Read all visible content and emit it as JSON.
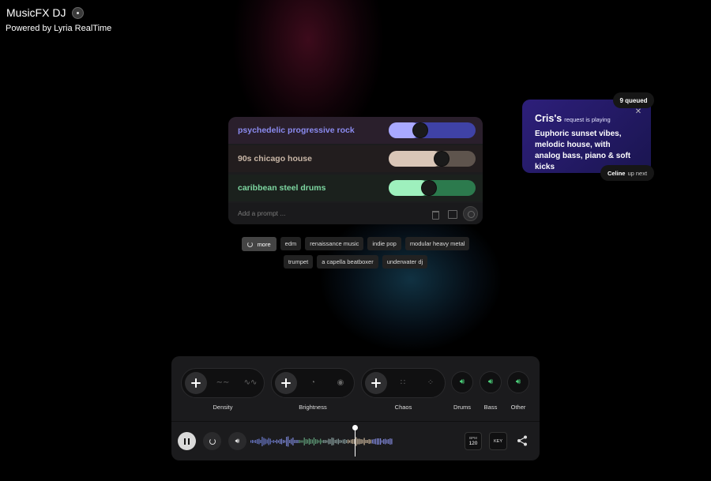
{
  "app": {
    "title": "MusicFX DJ",
    "subtitle": "Powered by Lyria RealTime"
  },
  "prompts": [
    {
      "label": "psychedelic progressive rock",
      "level": 0.33,
      "color": "#8b8bf0",
      "fill": "#a9a9ff",
      "track": "#3f42a6"
    },
    {
      "label": "90s chicago house",
      "level": 0.63,
      "color": "#c9b7a7",
      "fill": "#d9c6b7",
      "track": "#5e544d"
    },
    {
      "label": "caribbean steel drums",
      "level": 0.45,
      "color": "#7dd6a0",
      "fill": "#9ef0bd",
      "track": "#2c7a4d"
    }
  ],
  "add_prompt": {
    "placeholder": "Add a prompt ..."
  },
  "chips": [
    {
      "label": "more"
    },
    {
      "label": "edm"
    },
    {
      "label": "renaissance music"
    },
    {
      "label": "indie pop"
    },
    {
      "label": "modular heavy metal"
    },
    {
      "label": "trumpet"
    },
    {
      "label": "a capella beatboxer"
    },
    {
      "label": "underwater dj"
    }
  ],
  "queue": {
    "queued": "9 queued",
    "requester": "Cris's",
    "status": "request is playing",
    "description": "Euphoric sunset vibes, melodic house, with analog bass, piano & soft kicks",
    "next_name": "Celine",
    "next_text": "up next"
  },
  "controls": {
    "density": {
      "label": "Density"
    },
    "brightness": {
      "label": "Brightness"
    },
    "chaos": {
      "label": "Chaos"
    },
    "stems": [
      {
        "label": "Drums"
      },
      {
        "label": "Bass"
      },
      {
        "label": "Other"
      }
    ]
  },
  "transport": {
    "bpm_label": "BPM",
    "bpm_value": "120",
    "key_label": "KEY"
  }
}
